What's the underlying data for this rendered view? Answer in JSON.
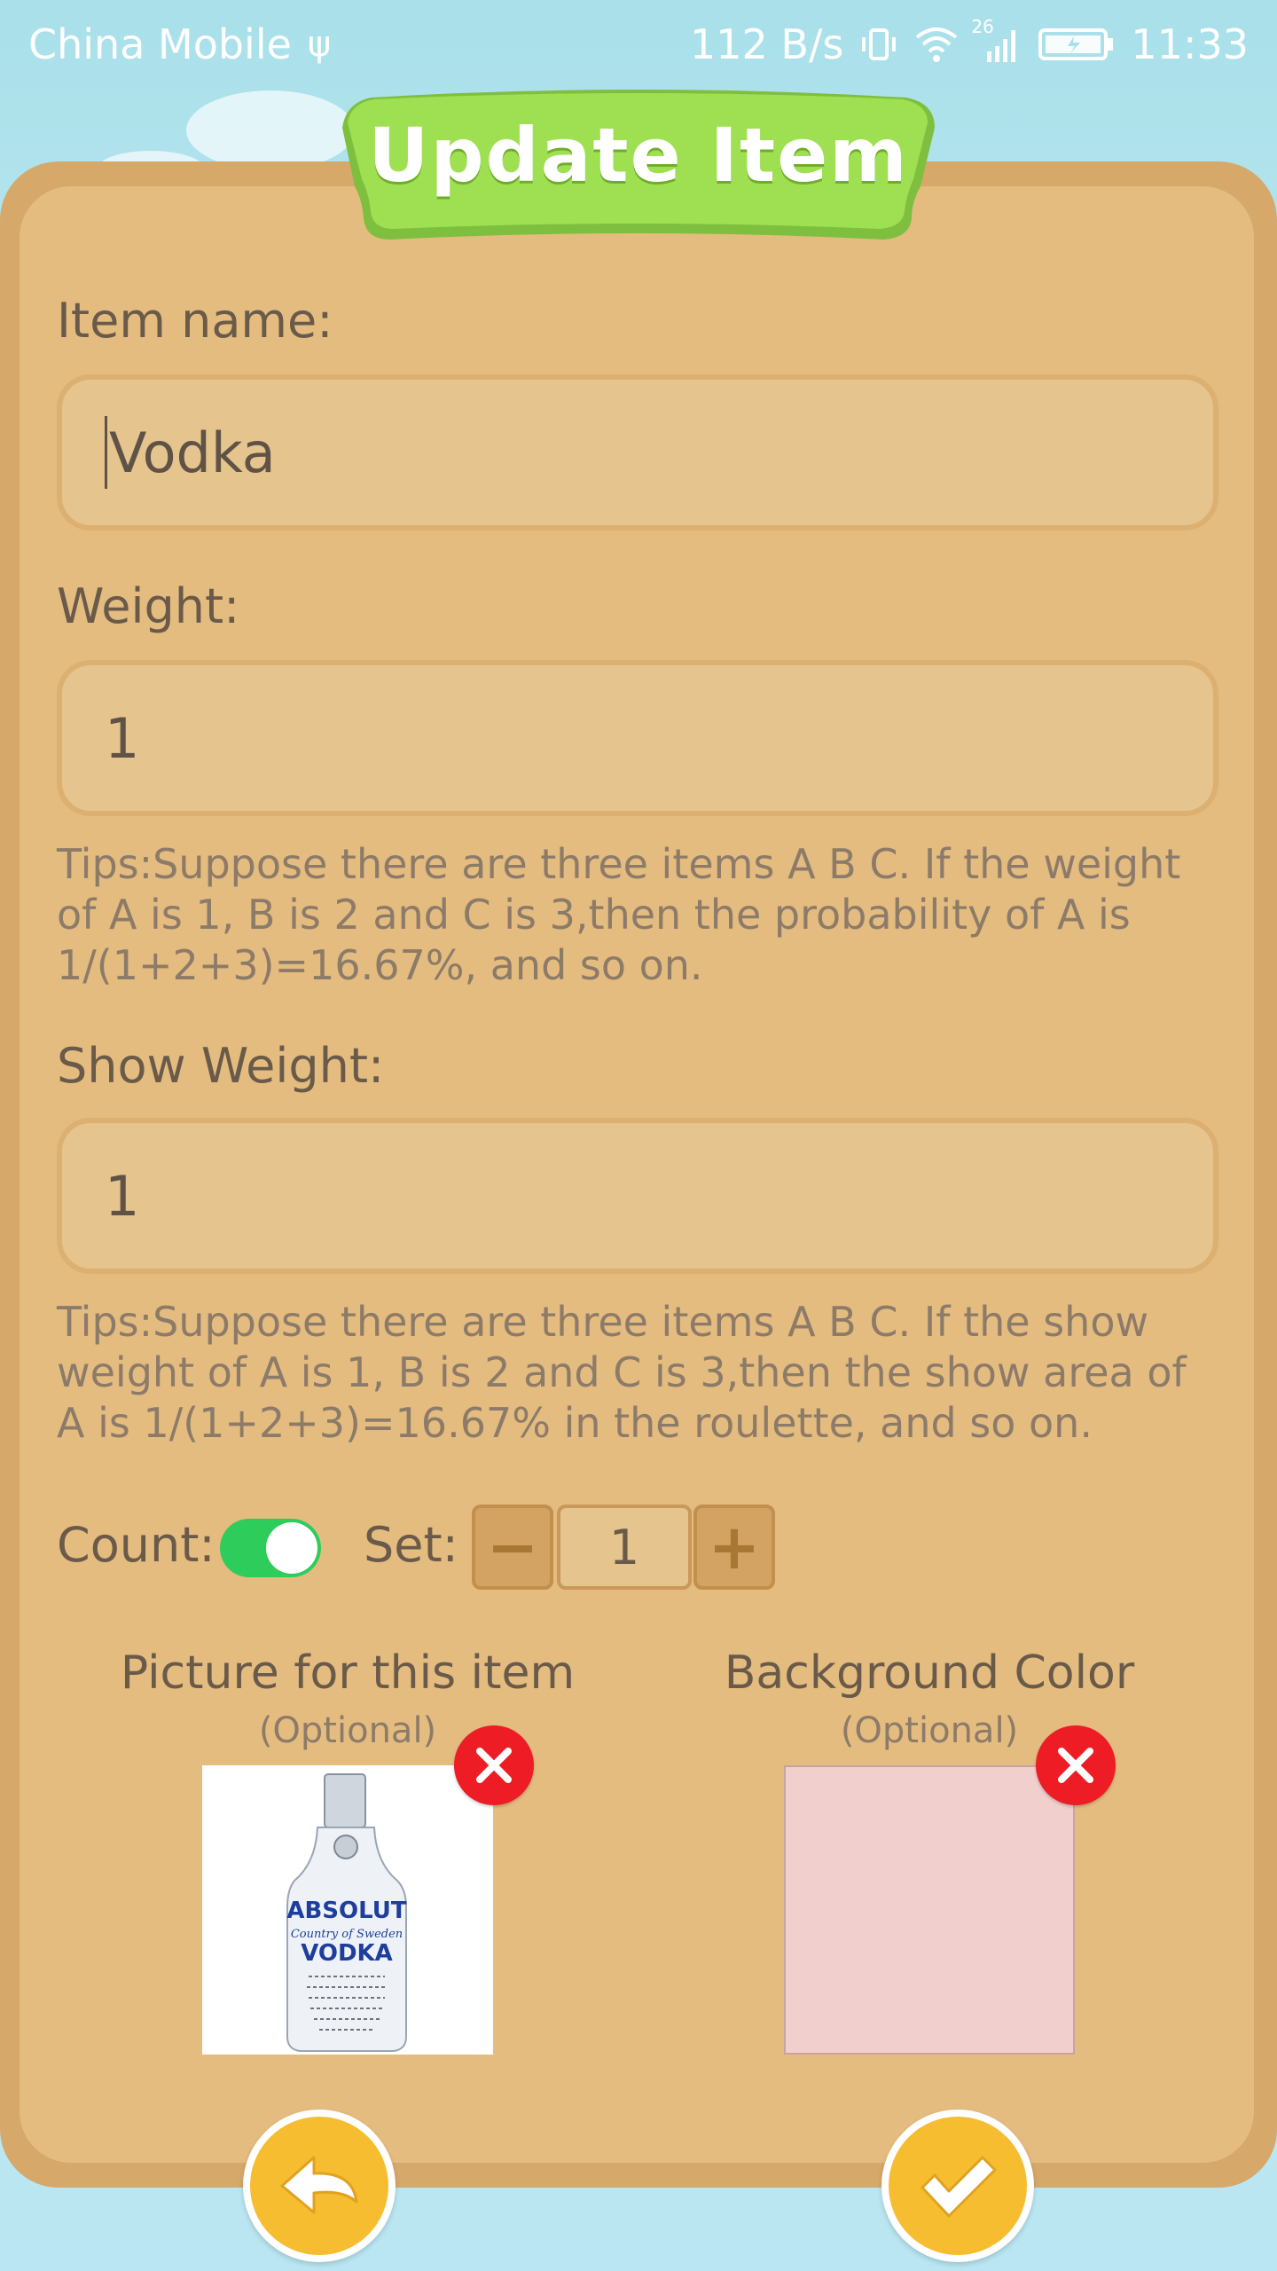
{
  "status_bar": {
    "carrier": "China Mobile",
    "speed": "112 B/s",
    "network_badge": "26",
    "time": "11:33"
  },
  "dialog": {
    "title": "Update Item"
  },
  "form": {
    "item_name_label": "Item name:",
    "item_name_value": "Vodka",
    "weight_label": "Weight:",
    "weight_value": "1",
    "weight_tips": "Tips:Suppose there are three items A B C. If the weight of A is 1, B is 2 and C is 3,then the probability of A is 1/(1+2+3)=16.67%, and so on.",
    "show_weight_label": "Show Weight:",
    "show_weight_value": "1",
    "show_weight_tips": "Tips:Suppose there are three items A B C. If the show weight of A is 1, B is 2 and C is 3,then the show area of A is 1/(1+2+3)=16.67% in the roulette, and so on.",
    "count_label": "Count:",
    "count_enabled": true,
    "set_label": "Set:",
    "set_value": "1",
    "minus_symbol": "−",
    "plus_symbol": "+"
  },
  "picture": {
    "title": "Picture for this item",
    "optional": "(Optional)",
    "image_text": {
      "brand": "ABSOLUT",
      "line1": "Country of Sweden",
      "product": "VODKA"
    }
  },
  "background_color": {
    "title": "Background Color",
    "optional": "(Optional)",
    "color": "#f1cfcc"
  },
  "colors": {
    "board": "#e4bc7f",
    "banner": "#9fe052",
    "toggle_on": "#2ecc5b",
    "remove": "#ee1c24",
    "action": "#f7bd31"
  },
  "icons": [
    "usb-icon",
    "vibrate-icon",
    "wifi-icon",
    "signal-icon",
    "battery-icon",
    "close-icon",
    "back-arrow-icon",
    "check-icon"
  ]
}
